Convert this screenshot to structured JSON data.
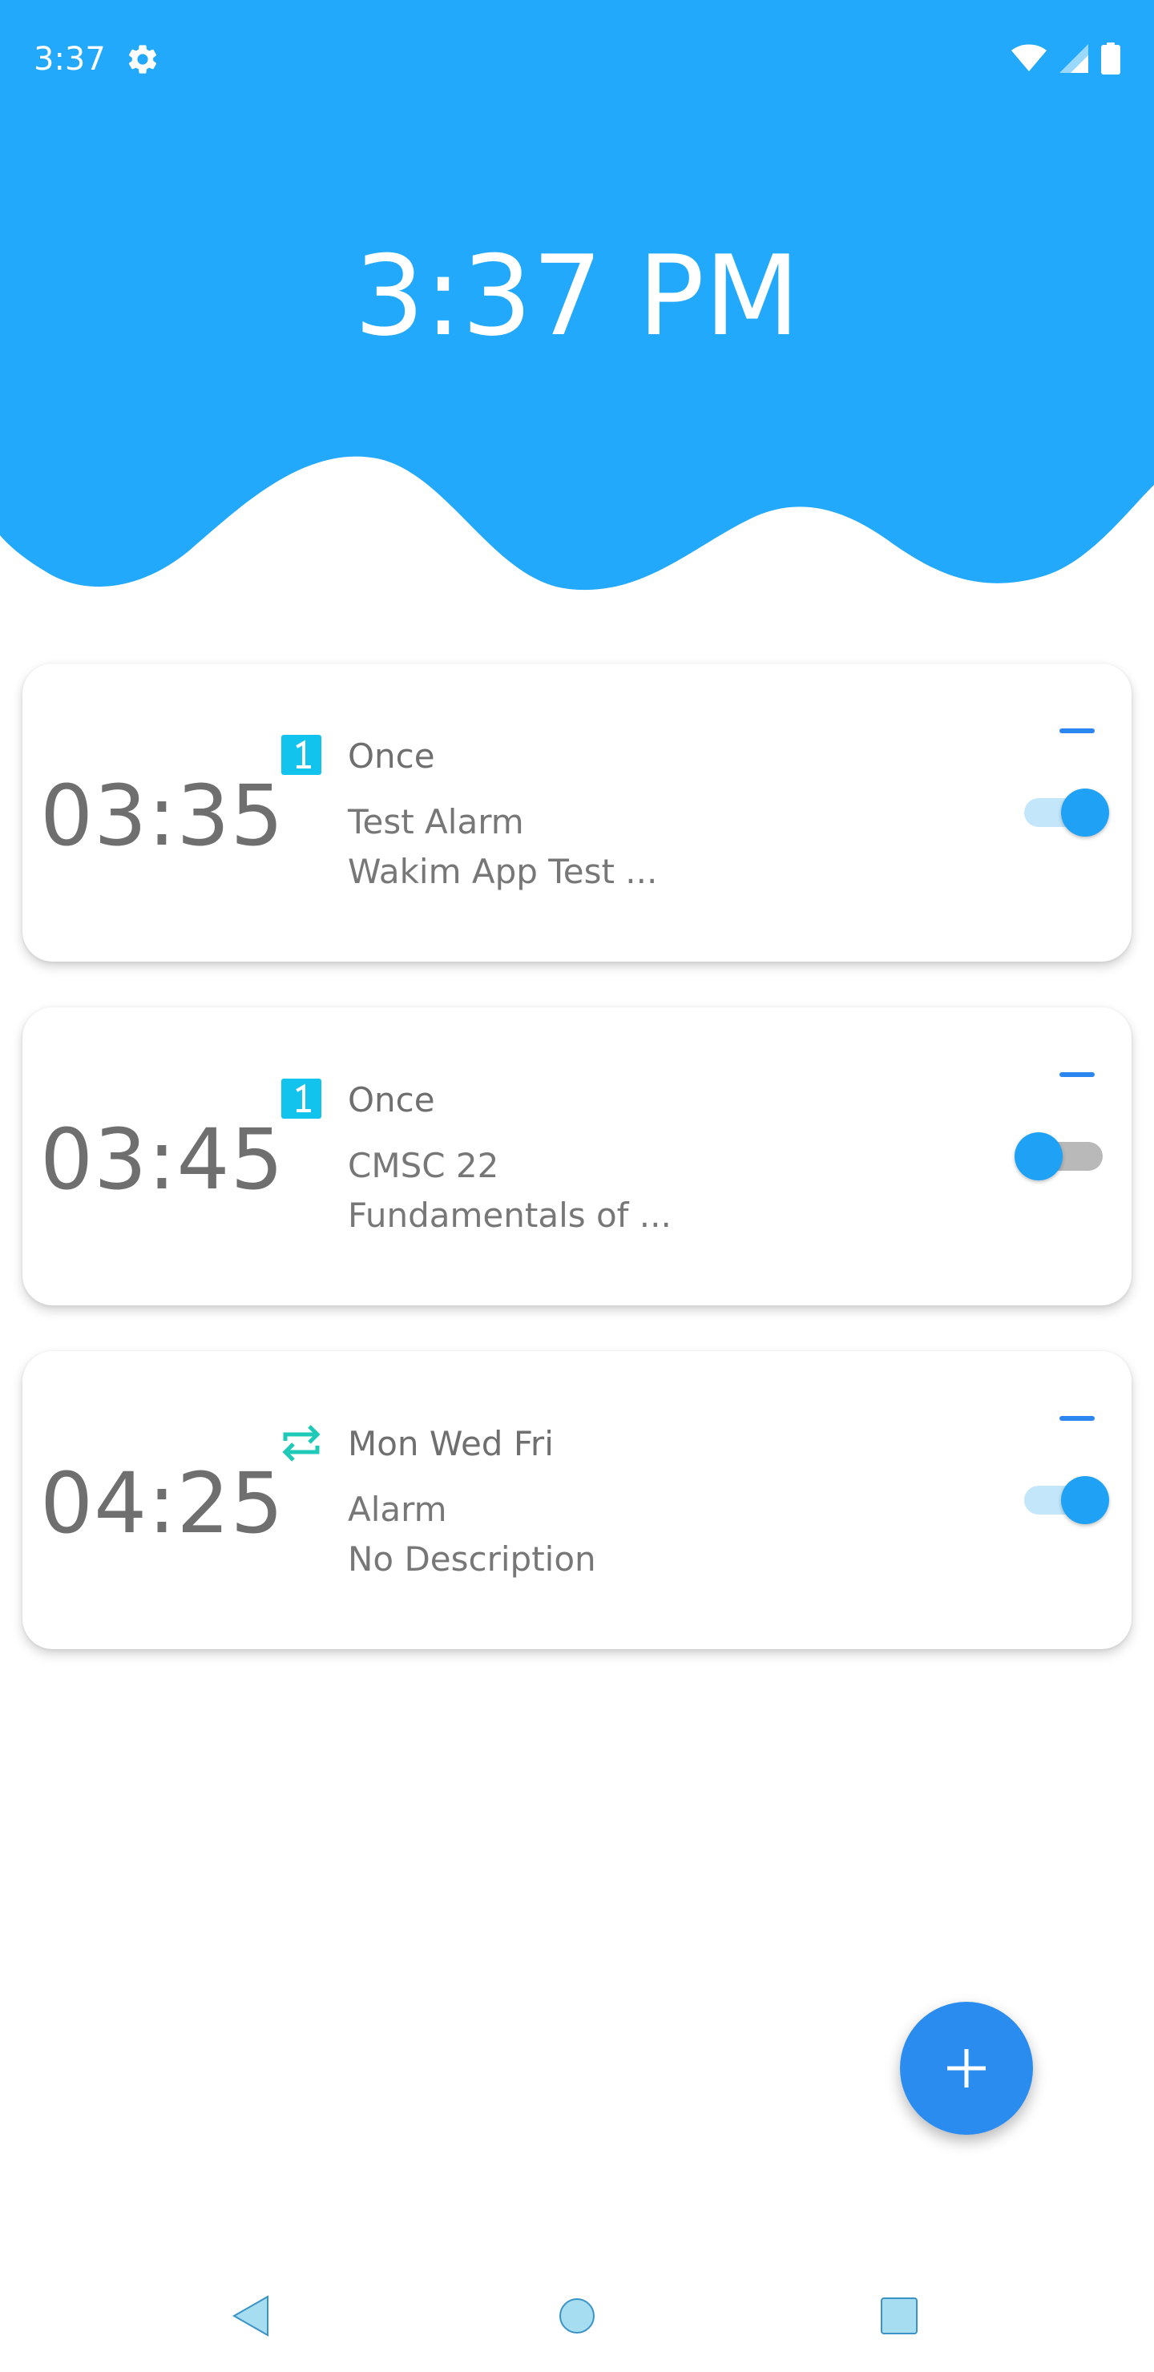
{
  "status_bar": {
    "time": "3:37",
    "icons": [
      "settings-gear-icon",
      "wifi-icon",
      "cell-signal-icon",
      "battery-icon"
    ]
  },
  "header": {
    "clock": "3:37 PM"
  },
  "alarms": [
    {
      "time": "03:35",
      "repeat_icon": "once-calendar-icon",
      "repeat_label": "Once",
      "title": "Test Alarm",
      "description": "Wakim App Test ...",
      "enabled": true
    },
    {
      "time": "03:45",
      "repeat_icon": "once-calendar-icon",
      "repeat_label": "Once",
      "title": "CMSC 22",
      "description": "Fundamentals of ...",
      "enabled": false
    },
    {
      "time": "04:25",
      "repeat_icon": "repeat-icon",
      "repeat_label": "Mon Wed Fri",
      "title": "Alarm",
      "description": "No Description",
      "enabled": true
    }
  ],
  "fab": {
    "icon": "plus-icon"
  },
  "nav_bar": {
    "buttons": [
      "back-icon",
      "home-icon",
      "recents-icon"
    ]
  },
  "colors": {
    "header_blue": "#22a9fb",
    "accent_blue": "#2b86ef",
    "switch_on": "#1fa2f6",
    "repeat_teal": "#1fc9b8",
    "once_badge": "#12c3ee",
    "text_gray": "#6f6f6f"
  }
}
